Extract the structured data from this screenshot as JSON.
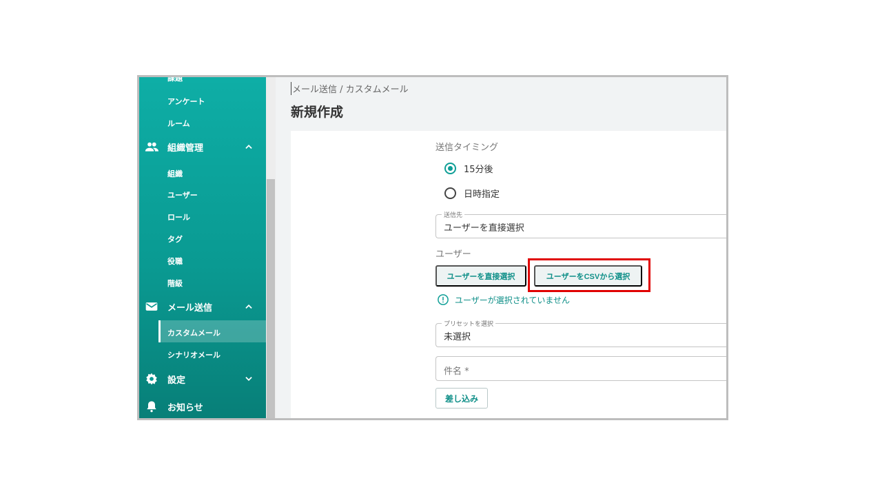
{
  "sidebar": {
    "items": [
      {
        "label": "課題",
        "type": "sub"
      },
      {
        "label": "アンケート",
        "type": "sub"
      },
      {
        "label": "ルーム",
        "type": "sub"
      },
      {
        "label": "組織管理",
        "type": "group",
        "icon": "people-icon",
        "expanded": true
      },
      {
        "label": "組織",
        "type": "sub"
      },
      {
        "label": "ユーザー",
        "type": "sub"
      },
      {
        "label": "ロール",
        "type": "sub"
      },
      {
        "label": "タグ",
        "type": "sub"
      },
      {
        "label": "役職",
        "type": "sub"
      },
      {
        "label": "階級",
        "type": "sub"
      },
      {
        "label": "メール送信",
        "type": "group",
        "icon": "mail-icon",
        "expanded": true
      },
      {
        "label": "カスタムメール",
        "type": "sub",
        "active": true
      },
      {
        "label": "シナリオメール",
        "type": "sub"
      },
      {
        "label": "設定",
        "type": "group",
        "icon": "gear-icon",
        "expanded": false
      },
      {
        "label": "お知らせ",
        "type": "group",
        "icon": "bell-icon"
      }
    ]
  },
  "header": {
    "breadcrumb": "メール送信 / カスタムメール",
    "title": "新規作成"
  },
  "form": {
    "timing": {
      "label": "送信タイミング",
      "options": [
        "15分後",
        "日時指定"
      ],
      "selected": "15分後"
    },
    "destination": {
      "legend": "送信先",
      "value": "ユーザーを直接選択"
    },
    "users": {
      "label": "ユーザー",
      "direct_button": "ユーザーを直接選択",
      "csv_button": "ユーザーをCSVから選択",
      "warning": "ユーザーが選択されていません"
    },
    "preset": {
      "legend": "プリセットを選択",
      "value": "未選択"
    },
    "subject": {
      "placeholder": "件名 *"
    },
    "insert_button": "差し込み"
  },
  "colors": {
    "accent": "#0e9e96",
    "sidebar_top": "#0eaea6",
    "sidebar_bottom": "#087f78",
    "highlight": "#e00000"
  }
}
